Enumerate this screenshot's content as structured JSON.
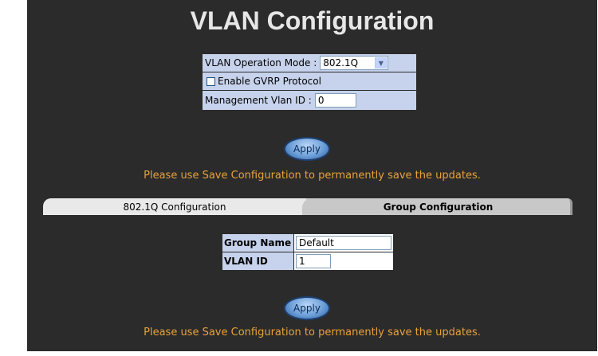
{
  "title": "VLAN Configuration",
  "mode": {
    "operation_mode_label": "VLAN Operation Mode :",
    "operation_mode_value": "802.1Q",
    "gvrp_label": "Enable GVRP Protocol",
    "gvrp_checked": false,
    "mgmt_vlan_label": "Management Vlan ID :",
    "mgmt_vlan_value": "0"
  },
  "apply_label": "Apply",
  "save_note": "Please use Save Configuration to permanently save the updates.",
  "tabs": [
    {
      "label": "802.1Q Configuration",
      "active": false
    },
    {
      "label": "Group Configuration",
      "active": true
    }
  ],
  "group": {
    "name_label": "Group Name",
    "name_value": "Default",
    "vlan_id_label": "VLAN ID",
    "vlan_id_value": "1"
  },
  "colors": {
    "panel_bg": "#2b2b2b",
    "table_bg": "#c7d3ec",
    "note_text": "#e8a23a"
  }
}
